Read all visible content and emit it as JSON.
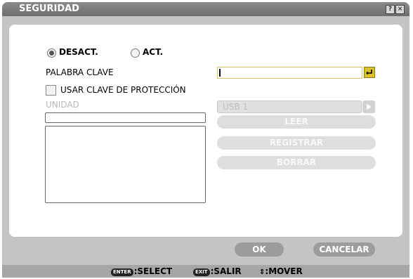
{
  "window": {
    "title": "SEGURIDAD",
    "help_glyph": "?",
    "close_glyph": "×"
  },
  "security": {
    "options": [
      {
        "label": "DESACT.",
        "selected": true
      },
      {
        "label": "ACT.",
        "selected": false
      }
    ],
    "keyword_label": "PALABRA CLAVE",
    "keyword_value": "",
    "protect_key_label": "USAR CLAVE DE PROTECCIÓN",
    "protect_key_checked": false,
    "unit_label": "UNIDAD",
    "unit_selected": "USB 1"
  },
  "actions": {
    "read": "LEER",
    "register": "REGISTRAR",
    "delete": "BORRAR"
  },
  "buttons": {
    "ok": "OK",
    "cancel": "CANCELAR"
  },
  "footer": {
    "enter_key": "ENTER",
    "select_text": ":SELECT",
    "exit_key": "EXIT",
    "exit_text": ":SALIR",
    "move_glyph": "⇕",
    "move_text": ":MOVER"
  },
  "colors": {
    "title_bar": "#7a7a7a",
    "enter_icon": "#d8c22a",
    "disabled_text": "#b8b8b8",
    "button": "#9c9c9c"
  },
  "icons": {
    "enter": "enter-return-icon",
    "dropdown": "triangle-right-icon",
    "help": "question-icon",
    "close": "close-icon"
  }
}
